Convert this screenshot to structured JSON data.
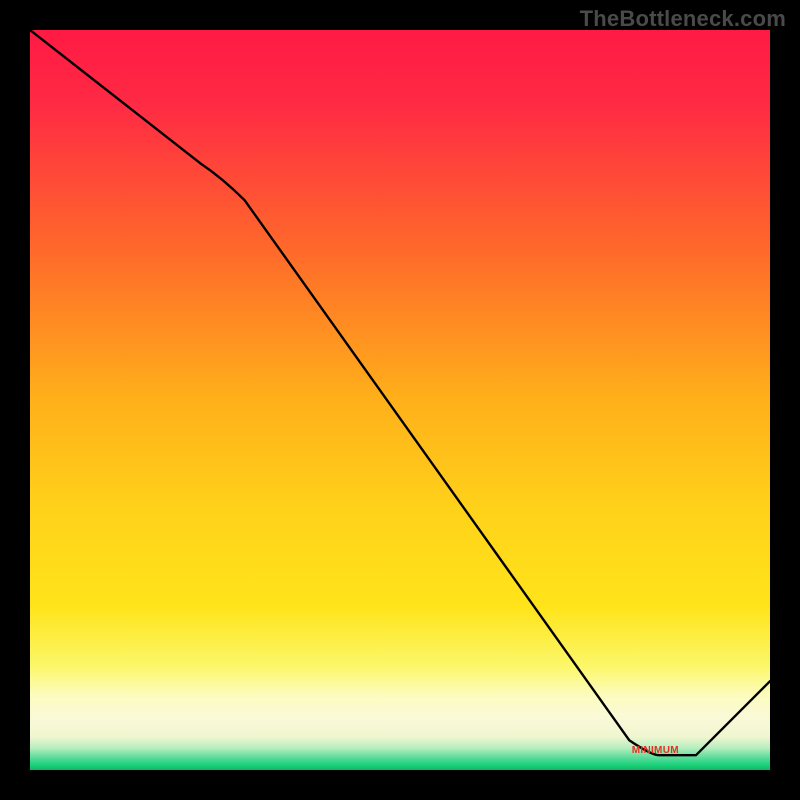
{
  "watermark": "TheBottleneck.com",
  "min_label": "MINIMUM",
  "colors": {
    "black": "#000000",
    "red_top": "#ff1a44",
    "orange": "#ff9a1a",
    "yellow": "#ffe41a",
    "pale_yellow": "#fcfcc0",
    "green": "#1ad37a",
    "curve": "#000000",
    "label": "#e63020",
    "watermark": "#4a4a4a"
  },
  "chart_data": {
    "type": "line",
    "title": "",
    "xlabel": "",
    "ylabel": "",
    "xlim": [
      0,
      100
    ],
    "ylim": [
      0,
      100
    ],
    "x": [
      0,
      26,
      84,
      90,
      100
    ],
    "values": [
      100,
      80,
      2,
      2,
      12
    ],
    "minimum_region": {
      "x_start": 79,
      "x_end": 90,
      "y": 2
    },
    "annotation": {
      "text": "MINIMUM",
      "x": 84.5,
      "y": 2
    },
    "background_gradient_stops": [
      {
        "offset": 0.0,
        "color": "#ff1a44"
      },
      {
        "offset": 0.5,
        "color": "#ffb01a"
      },
      {
        "offset": 0.78,
        "color": "#ffe41a"
      },
      {
        "offset": 0.9,
        "color": "#fcfcc0"
      },
      {
        "offset": 0.955,
        "color": "#f5f9d0"
      },
      {
        "offset": 0.99,
        "color": "#1ad37a"
      },
      {
        "offset": 1.0,
        "color": "#14b566"
      }
    ]
  }
}
